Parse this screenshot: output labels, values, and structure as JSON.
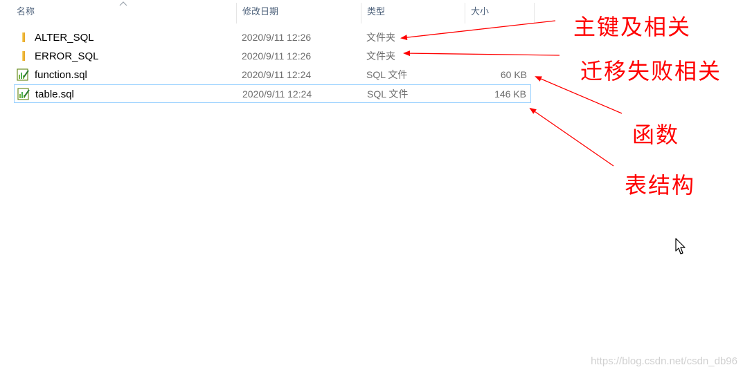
{
  "columns": {
    "name": "名称",
    "date": "修改日期",
    "type": "类型",
    "size": "大小"
  },
  "files": [
    {
      "name": "ALTER_SQL",
      "date": "2020/9/11 12:26",
      "type": "文件夹",
      "size": "",
      "icon": "folder-icon"
    },
    {
      "name": "ERROR_SQL",
      "date": "2020/9/11 12:26",
      "type": "文件夹",
      "size": "",
      "icon": "folder-icon"
    },
    {
      "name": "function.sql",
      "date": "2020/9/11 12:24",
      "type": "SQL 文件",
      "size": "60 KB",
      "icon": "sql-file-icon"
    },
    {
      "name": "table.sql",
      "date": "2020/9/11 12:24",
      "type": "SQL 文件",
      "size": "146 KB",
      "icon": "sql-file-icon",
      "selected": true
    }
  ],
  "annotations": {
    "primary_key": "主键及相关",
    "migration_failed": "迁移失败相关",
    "functions": "函数",
    "table_structure": "表结构"
  },
  "colors": {
    "annotation": "#ff0000",
    "header_text": "#4c607a",
    "selection_border": "#99d1ff",
    "folder": "#f5c342"
  },
  "watermark": "https://blog.csdn.net/csdn_db96"
}
